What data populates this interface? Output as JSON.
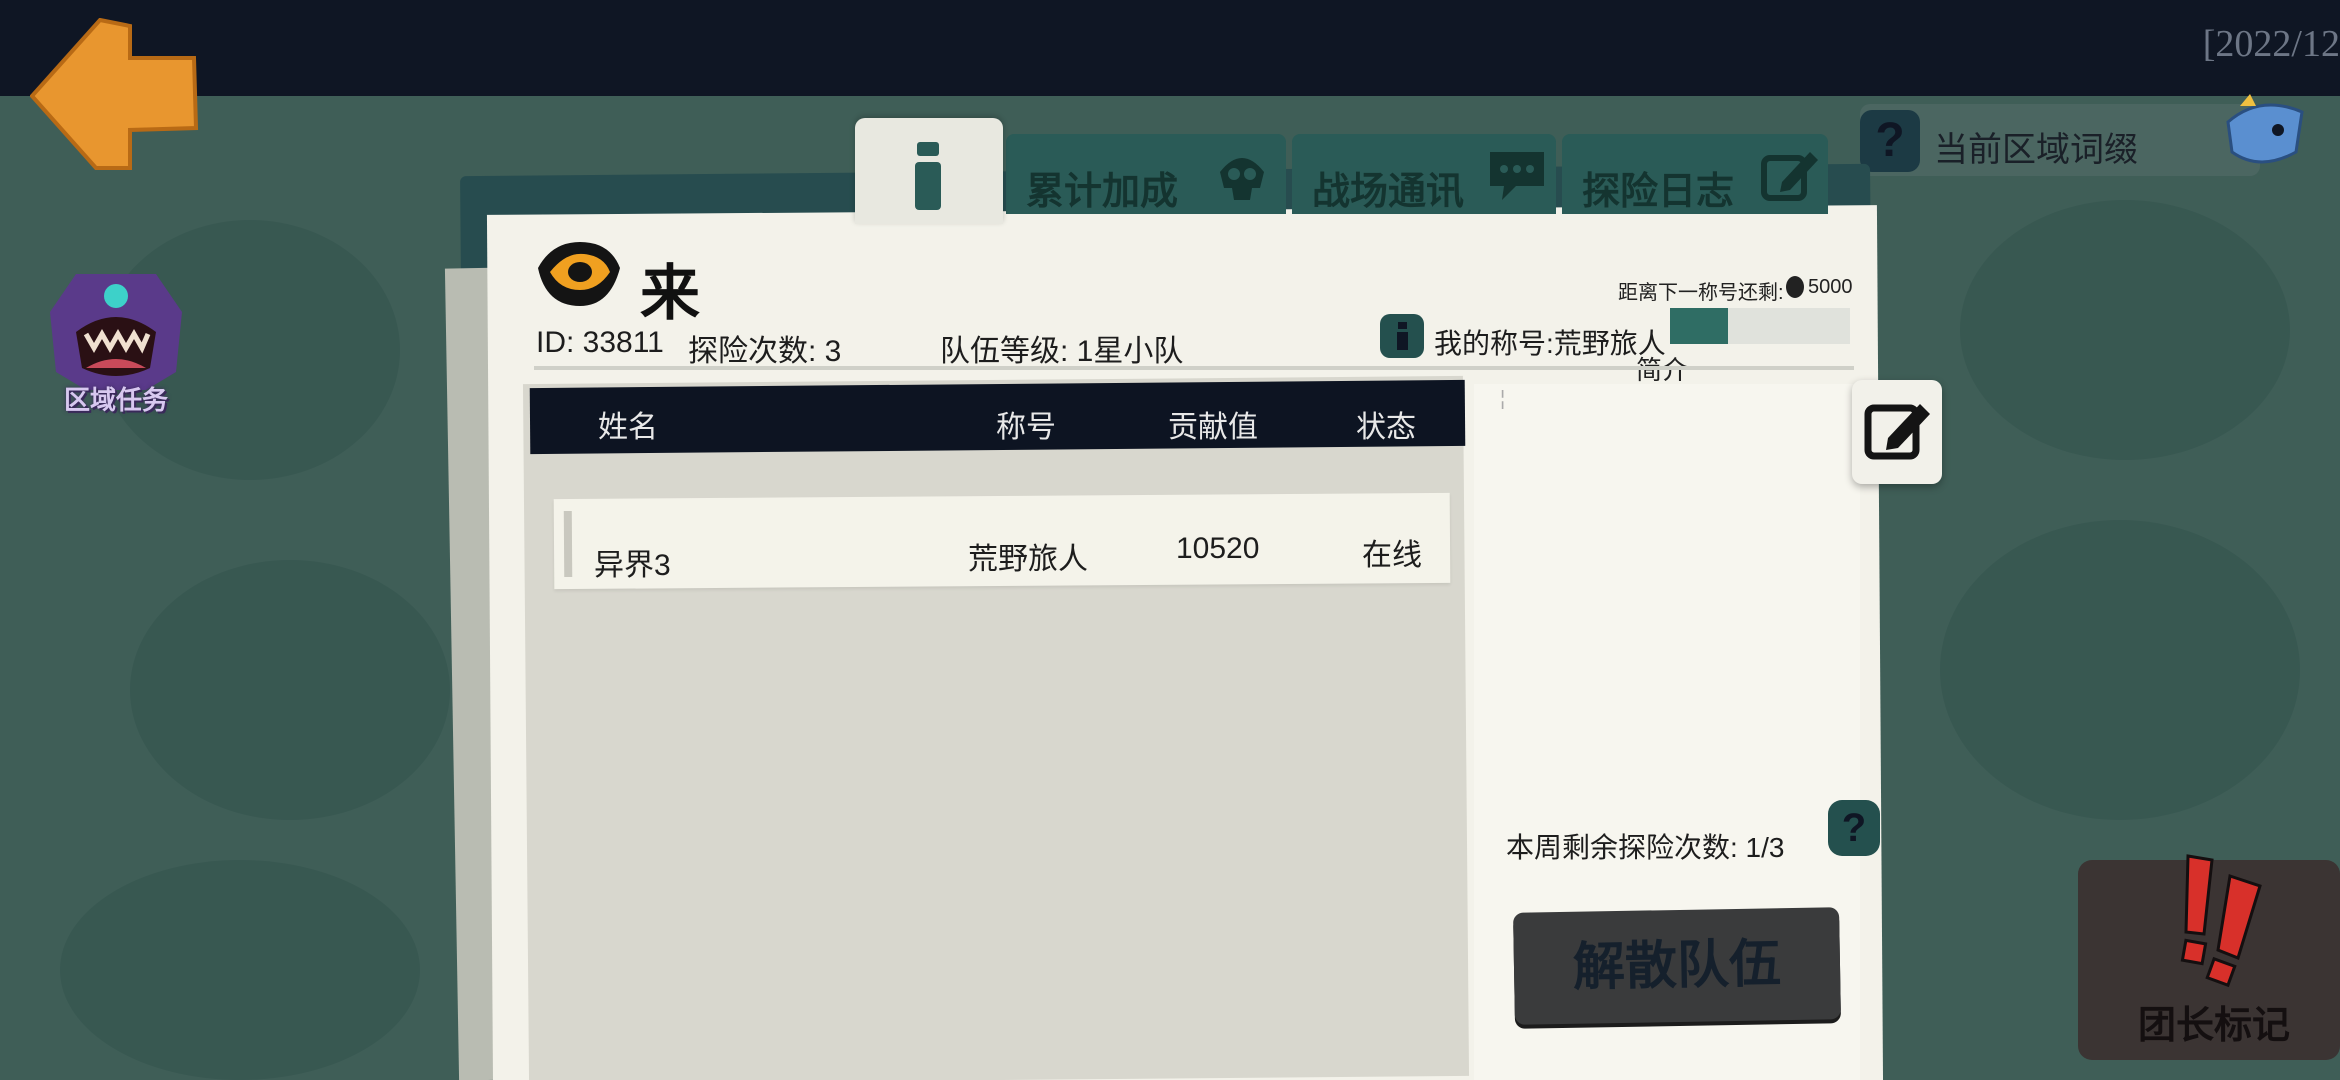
{
  "topbar": {
    "date": "[2022/12"
  },
  "nav": {
    "back_icon": "arrow-left-icon"
  },
  "side": {
    "region_task_label": "区域任务"
  },
  "affix": {
    "label": "当前区域词缀",
    "help_icon": "question-icon"
  },
  "tabs": [
    {
      "id": "info",
      "icon": "info-icon"
    },
    {
      "id": "bonus",
      "label": "累计加成",
      "icon": "skull-icon"
    },
    {
      "id": "comms",
      "label": "战场通讯",
      "icon": "chat-icon"
    },
    {
      "id": "log",
      "label": "探险日志",
      "icon": "edit-icon"
    }
  ],
  "team": {
    "name": "来",
    "id_text": "ID: 33811",
    "expedition_count": "探险次数: 3",
    "team_level": "队伍等级: 1星小队",
    "my_title": "我的称号:荒野旅人",
    "next_title_label": "距离下一称号还剩:",
    "next_title_value": "5000",
    "title_progress": 0.32,
    "intro_label": "简介"
  },
  "table": {
    "headers": [
      "姓名",
      "称号",
      "贡献值",
      "状态"
    ],
    "rows": [
      {
        "name": "异界3",
        "title": "荒野旅人",
        "contribution": "10520",
        "status": "在线"
      }
    ]
  },
  "footer": {
    "weekly_remaining": "本周剩余探险次数: 1/3",
    "disband_label": "解散队伍",
    "leader_mark_label": "团长标记"
  },
  "colors": {
    "accent": "#2a5b57",
    "header_dark": "#0d1422",
    "paper": "#f3f2ea",
    "back_orange": "#e8962f"
  }
}
